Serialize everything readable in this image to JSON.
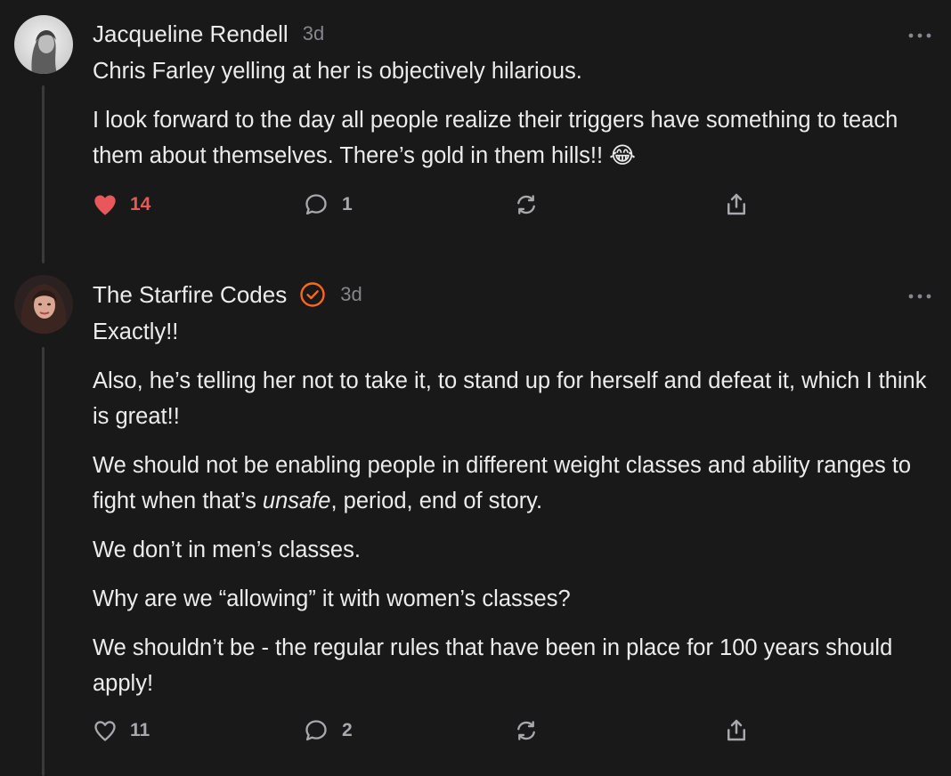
{
  "comments": [
    {
      "author": "Jacqueline Rendell",
      "time": "3d",
      "verified": false,
      "paragraphs": [
        "Chris Farley yelling at her is objectively hilarious.",
        "I look forward to the day all people realize their triggers have something to teach them about themselves. There’s gold in them hills!! 😂"
      ],
      "likes": "14",
      "liked": true,
      "replies": "1"
    },
    {
      "author": "The Starfire Codes",
      "time": "3d",
      "verified": true,
      "paragraphs": [
        "Exactly!!",
        "Also, he’s telling her not to take it, to stand up for herself and defeat it, which I think is great!!",
        {
          "before": "We should not be enabling people in different weight classes and ability ranges to fight when that’s ",
          "emphasis": "unsafe",
          "after": ", period, end of story."
        },
        "We don’t in men’s classes.",
        "Why are we “allowing” it with women’s classes?",
        "We shouldn’t be - the regular rules that have been in place for 100 years should apply!"
      ],
      "likes": "11",
      "liked": false,
      "replies": "2"
    }
  ],
  "colors": {
    "background": "#19191a",
    "text": "#ececec",
    "muted": "#86868b",
    "like_active": "#e8585b",
    "verified": "#ff6719",
    "thread_line": "#3a3a3c"
  }
}
